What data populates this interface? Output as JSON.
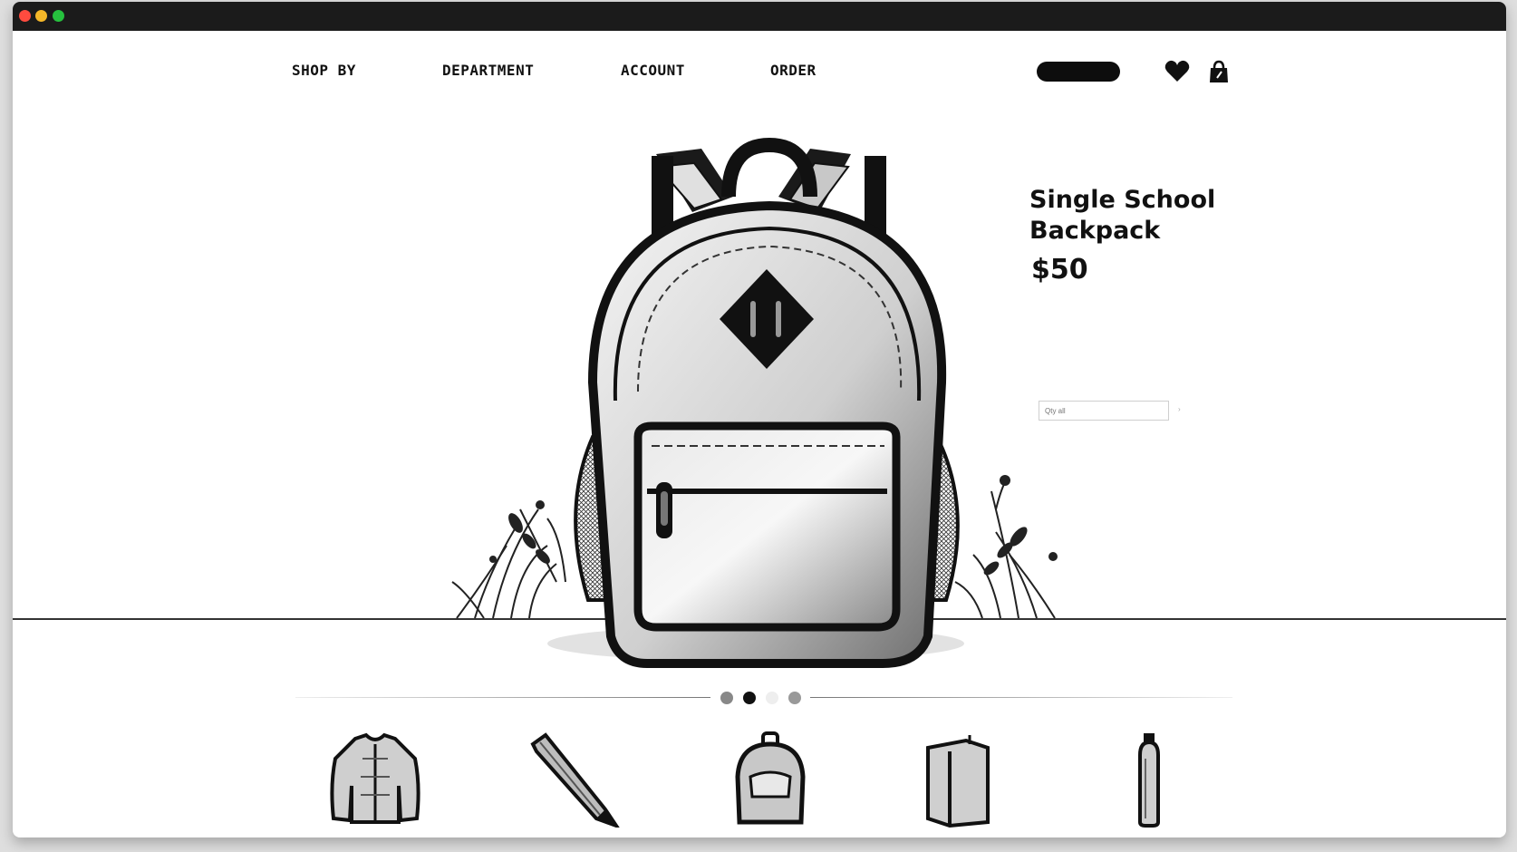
{
  "nav": {
    "items": [
      "SHOP BY",
      "DEPARTMENT",
      "ACCOUNT",
      "ORDER"
    ]
  },
  "icons": {
    "wishlist": "heart-icon",
    "cart": "shopping-bag-icon"
  },
  "product": {
    "title": "Single School Backpack",
    "price": "$50",
    "quantity_placeholder": "Qty all"
  },
  "carousel": {
    "slides": 4,
    "active_index": 1
  },
  "thumbnails": [
    "jacket",
    "pencil",
    "small backpack",
    "notebook",
    "water bottle"
  ],
  "colors": {
    "ink": "#111111",
    "background": "#ffffff",
    "titlebar": "#1b1b1b"
  }
}
